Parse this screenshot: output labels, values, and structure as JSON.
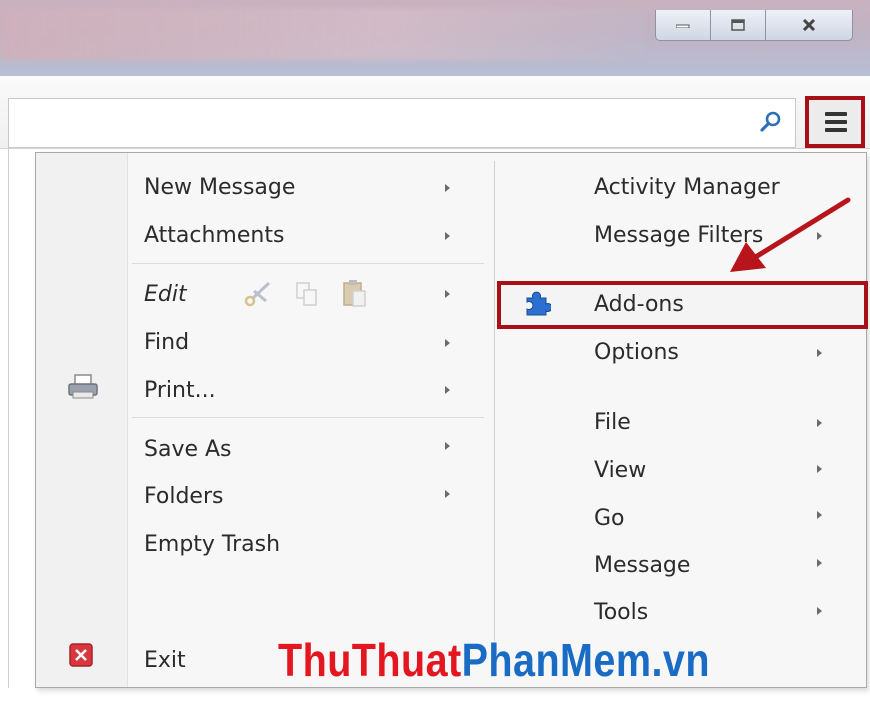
{
  "window": {
    "controls": [
      {
        "name": "minimize",
        "icon": "minimize-icon"
      },
      {
        "name": "maximize",
        "icon": "maximize-icon"
      },
      {
        "name": "close",
        "icon": "close-icon"
      }
    ]
  },
  "toolbar": {
    "search_placeholder": "",
    "search_icon": "search-icon",
    "menu_icon": "hamburger-menu-icon",
    "highlight_color": "#a80f16"
  },
  "menu": {
    "left": {
      "items": [
        {
          "label": "New Message",
          "submenu": true
        },
        {
          "label": "Attachments",
          "submenu": true
        },
        {
          "label": "Edit",
          "submenu": true,
          "icons": [
            "cut-icon",
            "copy-icon",
            "paste-icon"
          ]
        },
        {
          "label": "Find",
          "submenu": true
        },
        {
          "label": "Print...",
          "submenu": true,
          "icon": "printer-icon"
        },
        {
          "label": "Save As",
          "submenu": true
        },
        {
          "label": "Folders",
          "submenu": true
        },
        {
          "label": "Empty Trash",
          "submenu": false
        },
        {
          "label": "Exit",
          "submenu": false,
          "icon": "exit-icon"
        }
      ]
    },
    "right": {
      "items": [
        {
          "label": "Activity Manager",
          "submenu": false
        },
        {
          "label": "Message Filters",
          "submenu": true
        },
        {
          "label": "Add-ons",
          "submenu": false,
          "icon": "puzzle-piece-icon",
          "highlighted": true
        },
        {
          "label": "Options",
          "submenu": true
        },
        {
          "label": "File",
          "submenu": true
        },
        {
          "label": "View",
          "submenu": true
        },
        {
          "label": "Go",
          "submenu": true
        },
        {
          "label": "Message",
          "submenu": true
        },
        {
          "label": "Tools",
          "submenu": true
        }
      ]
    }
  },
  "watermark": {
    "part1": "ThuThuat",
    "part2": "PhanMem.vn",
    "color1": "#e4161f",
    "color2": "#1a6bc4"
  }
}
